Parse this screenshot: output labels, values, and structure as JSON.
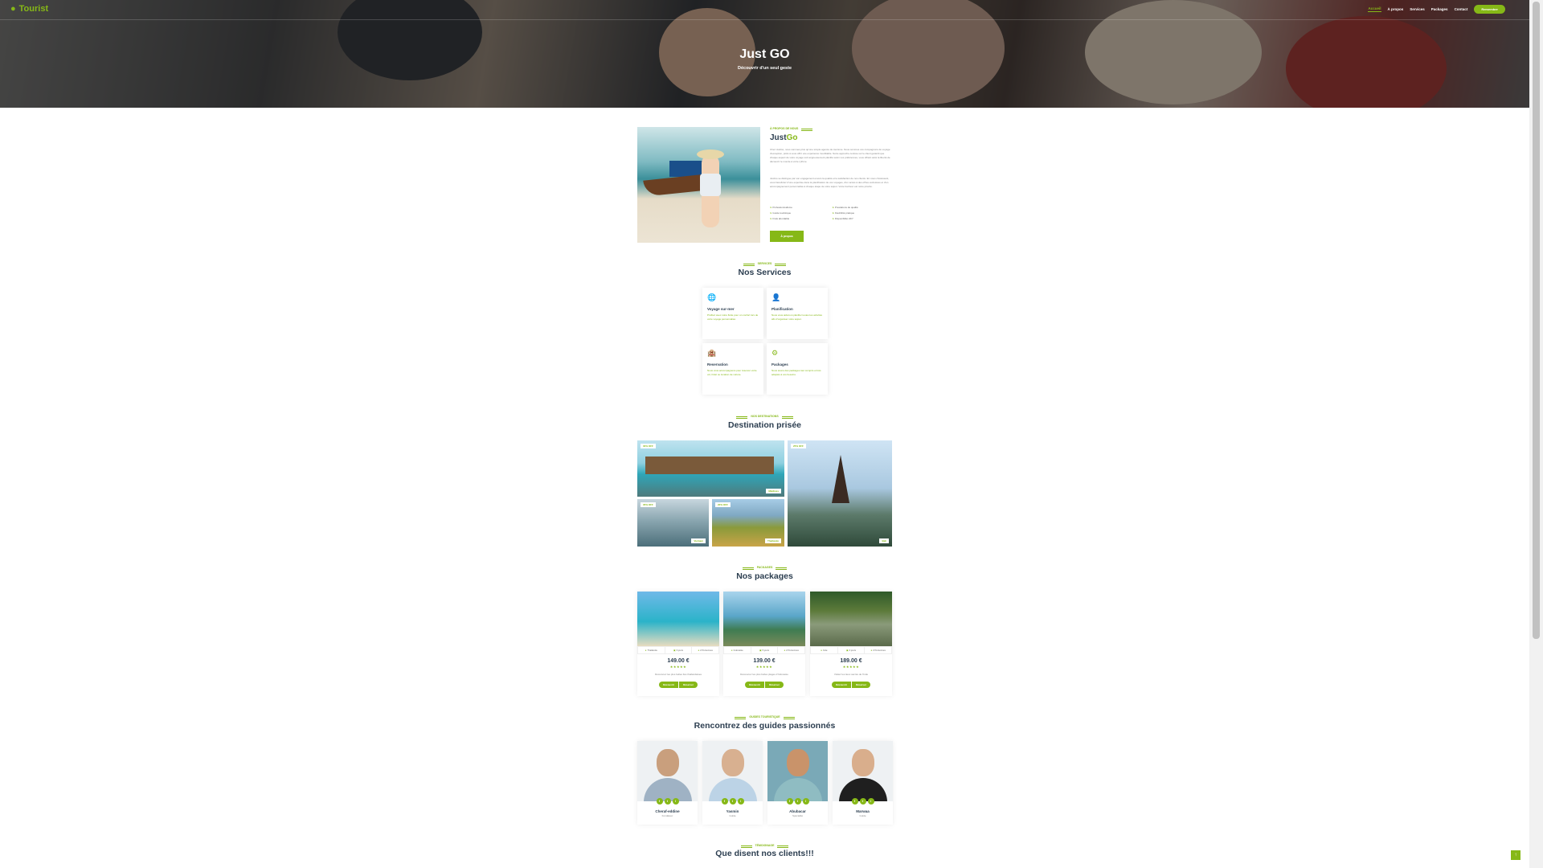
{
  "brand": {
    "name": "Tourist",
    "accent": "#86b817",
    "dark": "#2c3e50"
  },
  "nav": {
    "links": [
      "Accueil",
      "À propos",
      "Services",
      "Packages",
      "Contact"
    ],
    "active": "Accueil",
    "cta": "Remember"
  },
  "hero": {
    "title": "Just GO",
    "subtitle": "Découvrir d'un seul geste"
  },
  "about": {
    "tag": "À PROPOS DE NOUS",
    "title_main": "Just",
    "title_accent": "Go",
    "paragraph1": "Chez JustGo, nous sommes plus qu'une simple agence de tourisme. Nous sommes vos compagnons de voyage d'exception, prêts à vous offrir une expérience inoubliable. Notre approche centrée sur le client garantit que chaque aspect de votre voyage soit soigneusement planifié selon vos préférences, vous offrant ainsi la liberté de découvrir le monde à votre rythme.",
    "paragraph2": "JustGo se distingue par son engagement envers la qualité et la satisfaction de nos clients. En nous choisissant, vous bénéficiez d'une expertise dans la planification de vos voyages, d'un accès à des offres exclusives et d'un accompagnement personnalisé à chaque étape de votre séjour. Votre bonheur est notre priorité.",
    "features": [
      "Professionnalisme",
      "Guide touristique",
      "Frais abordable",
      "Prestations de qualité",
      "Flexibilité pratique",
      "Disponibilité 24/7"
    ],
    "button": "À propos"
  },
  "services": {
    "tag": "SERVICES",
    "title": "Nos Services",
    "items": [
      {
        "title": "Voyage sur-mer",
        "desc": "Profitez avec notre flotte pour un confort lors de votre voyage personnalisé."
      },
      {
        "title": "Planification",
        "desc": "Nous vous aidons à planifier toutes les activités afin d'organiser votre séjour."
      },
      {
        "title": "Reservation",
        "desc": "Nous vous accompagnons pour réserver votre vol, hôtel ou location de voiture."
      },
      {
        "title": "Packages",
        "desc": "Nous avons des packages tout compris et très adaptés à vos besoins."
      }
    ]
  },
  "destinations": {
    "tag": "NOS DESTINATIONS",
    "title": "Destination prisée",
    "items": [
      {
        "badge": "30% OFF",
        "name": "Maldives"
      },
      {
        "badge": "25% OFF",
        "name": "Bali"
      },
      {
        "badge": "35% OFF",
        "name": "Vietnam"
      },
      {
        "badge": "20% OFF",
        "name": "Thaïlande"
      }
    ]
  },
  "packages": {
    "tag": "PACKAGES",
    "title": "Nos packages",
    "items": [
      {
        "location": "Thaïlande",
        "duration": "3 jours",
        "persons": "2 Personnes",
        "price": "149.00 €",
        "desc": "Découvrez les plus belles îles thaïlandaises",
        "rating": 5
      },
      {
        "location": "Indonésie",
        "duration": "5 jours",
        "persons": "2 Personnes",
        "price": "139.00 €",
        "desc": "Découvrez les plus belles plages d'Indonésie",
        "rating": 5
      },
      {
        "location": "Inde",
        "duration": "4 jours",
        "persons": "2 Personnes",
        "price": "189.00 €",
        "desc": "Visitez les lieux sacrés de l'Inde",
        "rating": 5
      }
    ],
    "button_more": "Découvrir",
    "button_book": "Réserver"
  },
  "guides": {
    "tag": "GUIDES TOURISTIQUE",
    "title": "Rencontrez des guides passionnés",
    "items": [
      {
        "name": "Cheraf-eddine",
        "role": "Fondateur"
      },
      {
        "name": "Yasmin",
        "role": "Guide"
      },
      {
        "name": "Abubacar",
        "role": "Spécialité"
      },
      {
        "name": "Marwaa",
        "role": "Guide"
      }
    ],
    "social_icons": [
      "facebook-icon",
      "twitter-icon",
      "instagram-icon"
    ]
  },
  "testimonials": {
    "tag": "TÉMOIGNAGE",
    "title": "Que disent nos clients!!!"
  }
}
